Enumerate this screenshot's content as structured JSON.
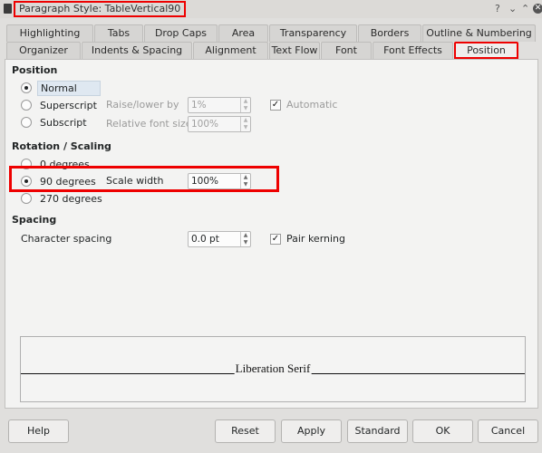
{
  "window": {
    "title": "Paragraph Style: TableVertical90",
    "controls": {
      "help": "?",
      "minimize": "⌄",
      "maximize": "⌃",
      "close": "✕"
    }
  },
  "tabs": {
    "row1": [
      "Highlighting",
      "Tabs",
      "Drop Caps",
      "Area",
      "Transparency",
      "Borders",
      "Outline & Numbering"
    ],
    "row2": [
      "Organizer",
      "Indents & Spacing",
      "Alignment",
      "Text Flow",
      "Font",
      "Font Effects",
      "Position"
    ],
    "active": "Position"
  },
  "position": {
    "title": "Position",
    "options": [
      {
        "label": "Normal",
        "checked": true
      },
      {
        "label": "Superscript",
        "checked": false
      },
      {
        "label": "Subscript",
        "checked": false
      }
    ],
    "raise_lower_label": "Raise/lower by",
    "raise_lower_value": "1%",
    "relative_size_label": "Relative font size",
    "relative_size_value": "100%",
    "automatic_label": "Automatic",
    "automatic_checked": true
  },
  "rotation": {
    "title": "Rotation / Scaling",
    "options": [
      {
        "label": "0 degrees",
        "checked": false
      },
      {
        "label": "90 degrees",
        "checked": true
      },
      {
        "label": "270 degrees",
        "checked": false
      }
    ],
    "scale_width_label": "Scale width",
    "scale_width_value": "100%"
  },
  "spacing": {
    "title": "Spacing",
    "char_spacing_label": "Character spacing",
    "char_spacing_value": "0.0 pt",
    "pair_kerning_label": "Pair kerning",
    "pair_kerning_checked": true
  },
  "preview": {
    "text": "Liberation Serif"
  },
  "buttons": {
    "help": "Help",
    "reset": "Reset",
    "apply": "Apply",
    "standard": "Standard",
    "ok": "OK",
    "cancel": "Cancel"
  },
  "colors": {
    "highlight": "#ee0000"
  }
}
